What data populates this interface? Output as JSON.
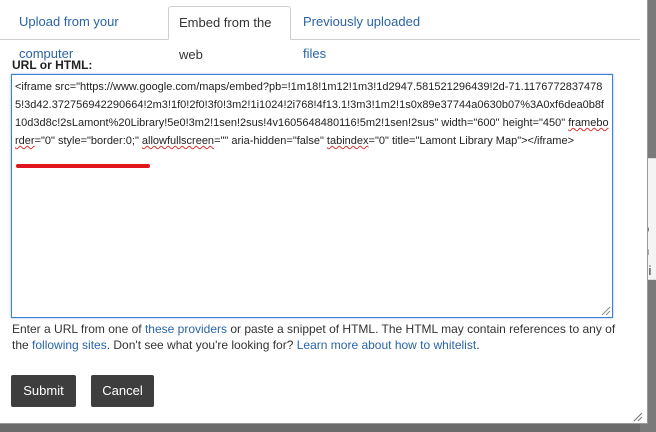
{
  "tabs": [
    {
      "label": "Upload from your computer"
    },
    {
      "label": "Embed from the web"
    },
    {
      "label": "Previously uploaded files"
    }
  ],
  "field": {
    "label": "URL or HTML:",
    "value_parts": [
      "<iframe src=\"https://www.google.com/maps/embed?pb=!1m18!1m12!1m3!1d2947.581521296439!2d-71.11767728374785!3d42.372756942290664!2m3!1f0!2f0!3f0!3m2!1i1024!2i768!4f13.1!3m3!1m2!1s0x89e37744a0630b07%3A0xf6dea0b8f10d3d8c!2sLamont%20Library!5e0!3m2!1sen!2sus!4v1605648480116!5m2!1sen!2sus\" width=\"600\" height=\"450\" ",
      "frameborder",
      "=\"0\" style=\"border:0;\" ",
      "allowfullscreen",
      "=\"\" aria-hidden=\"false\" ",
      "tabindex",
      "=\"0\" ",
      "title=\"Lamont Library Map\"",
      "></iframe>"
    ]
  },
  "help": {
    "t1": "Enter a URL from one of ",
    "link_providers": "these providers",
    "t2": " or paste a snippet of HTML. The HTML may contain references to any of the ",
    "link_sites": "following sites",
    "t3": ". Don't see what you're looking for? ",
    "link_whitelist": "Learn more about how to whitelist",
    "t4": "."
  },
  "buttons": {
    "submit": "Submit",
    "cancel": "Cancel"
  },
  "background": {
    "frag1": "li",
    "frag2": "o",
    "frag3": "n",
    "frag4": "si"
  },
  "colors": {
    "accent_link": "#2a64a8",
    "focus_border": "#3f7ed6",
    "highlight_underline": "#e0151e",
    "button_bg": "#3e3e3e"
  }
}
